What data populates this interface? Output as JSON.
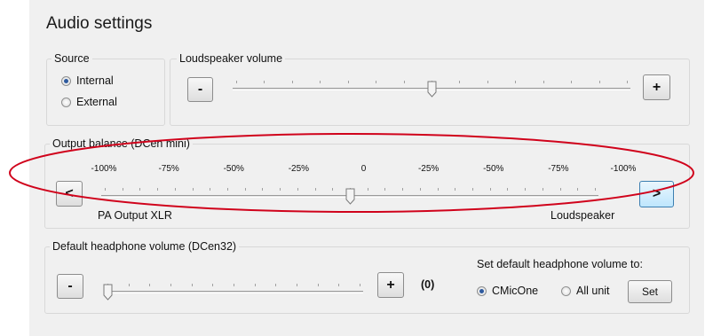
{
  "title": "Audio settings",
  "source": {
    "label": "Source",
    "options": [
      {
        "label": "Internal",
        "checked": true
      },
      {
        "label": "External",
        "checked": false
      }
    ]
  },
  "loudspeaker": {
    "label": "Loudspeaker volume",
    "minus_label": "-",
    "plus_label": "+",
    "slider_value": 0.5
  },
  "balance": {
    "label": "Output balance (DCen mini)",
    "scale": [
      "-100%",
      "-75%",
      "-50%",
      "-25%",
      "0",
      "-25%",
      "-50%",
      "-75%",
      "-100%"
    ],
    "left_button": "<",
    "right_button": ">",
    "left_caption": "PA Output XLR",
    "right_caption": "Loudspeaker",
    "slider_value": 0.5
  },
  "headphone": {
    "label": "Default headphone volume (DCen32)",
    "minus_label": "-",
    "plus_label": "+",
    "value_text": "(0)",
    "slider_value": 0,
    "set_default_label": "Set default headphone volume to:",
    "options": [
      {
        "label": "CMicOne",
        "checked": true
      },
      {
        "label": "All unit",
        "checked": false
      }
    ],
    "set_button": "Set"
  },
  "colors": {
    "panel": "#f0f0f0",
    "annotation": "#d0021b",
    "radio_dot": "#2d5a9e"
  }
}
